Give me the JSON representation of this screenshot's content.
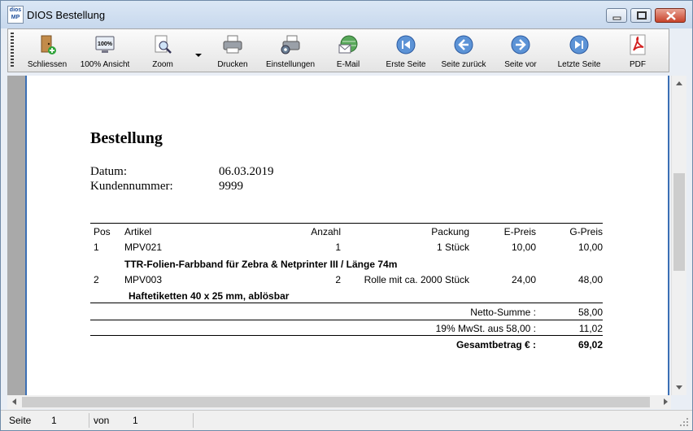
{
  "window": {
    "app_icon_text": [
      "dios",
      "MP"
    ],
    "title": "DIOS Bestellung"
  },
  "toolbar": {
    "items": [
      {
        "label": "Schliessen",
        "icon": "exit-door-icon"
      },
      {
        "label": "100% Ansicht",
        "icon": "monitor-100-icon"
      },
      {
        "label": "Zoom",
        "icon": "zoom-magnifier-icon"
      },
      {
        "label": "Drucken",
        "icon": "printer-icon"
      },
      {
        "label": "Einstellungen",
        "icon": "printer-settings-icon"
      },
      {
        "label": "E-Mail",
        "icon": "email-globe-icon"
      },
      {
        "label": "Erste Seite",
        "icon": "first-page-icon"
      },
      {
        "label": "Seite zurück",
        "icon": "previous-page-icon"
      },
      {
        "label": "Seite vor",
        "icon": "next-page-icon"
      },
      {
        "label": "Letzte Seite",
        "icon": "last-page-icon"
      },
      {
        "label": "PDF",
        "icon": "pdf-icon"
      }
    ],
    "monitor_text": "100%"
  },
  "report": {
    "title": "Bestellung",
    "date_label": "Datum:",
    "date_value": "06.03.2019",
    "customer_label": "Kundennummer:",
    "customer_value": "9999",
    "columns": [
      "Pos",
      "Artikel",
      "Anzahl",
      "Packung",
      "E-Preis",
      "G-Preis"
    ],
    "rows": [
      {
        "pos": "1",
        "artikel": "MPV021",
        "anzahl": "1",
        "packung": "1 Stück",
        "epreis": "10,00",
        "gpreis": "10,00",
        "beschreibung": "TTR-Folien-Farbband für Zebra & Netprinter III / Länge 74m"
      },
      {
        "pos": "2",
        "artikel": "MPV003",
        "anzahl": "2",
        "packung": "Rolle mit ca. 2000 Stück",
        "epreis": "24,00",
        "gpreis": "48,00",
        "beschreibung": "Haftetiketten 40 x 25 mm, ablösbar"
      }
    ],
    "netto_label": "Netto-Summe :",
    "netto_value": "58,00",
    "mwst_label": "19% MwSt. aus 58,00 :",
    "mwst_value": "11,02",
    "total_label": "Gesamtbetrag € :",
    "total_value": "69,02"
  },
  "statusbar": {
    "page_label": "Seite",
    "page_value": "1",
    "of_label": "von",
    "of_value": "1"
  },
  "colors": {
    "title_bar": "#c7d8ed",
    "page_border": "#3b6fb5",
    "close_button": "#c8432a"
  }
}
